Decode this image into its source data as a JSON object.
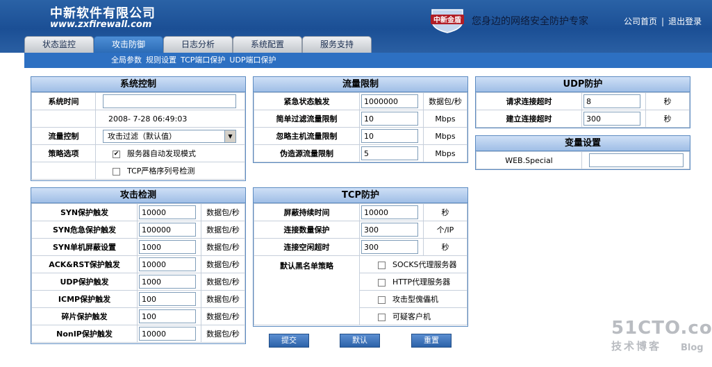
{
  "header": {
    "company": "中新软件有限公司",
    "url": "www.zxfirewall.com",
    "badge_text": "中新金盾",
    "slogan": "您身边的网络安全防护专家",
    "links": [
      "公司首页",
      "退出登录"
    ],
    "link_sep": "|"
  },
  "tabs": [
    {
      "label": "状态监控",
      "active": false
    },
    {
      "label": "攻击防御",
      "active": true
    },
    {
      "label": "日志分析",
      "active": false
    },
    {
      "label": "系统配置",
      "active": false
    },
    {
      "label": "服务支持",
      "active": false
    }
  ],
  "subnav": [
    "全局参数",
    "规则设置",
    "TCP端口保护",
    "UDP端口保护"
  ],
  "system_control": {
    "title": "系统控制",
    "time_label": "系统时间",
    "time_value": "",
    "datetime": "2008- 7-28 06:49:03",
    "flow_label": "流量控制",
    "flow_selected": "攻击过滤（默认值）",
    "policy_label": "策略选项",
    "option1": "服务器自动发现模式",
    "option1_checked": true,
    "option1_mark": "✔",
    "option2": "TCP严格序列号检测",
    "option2_checked": false
  },
  "traffic_limit": {
    "title": "流量限制",
    "rows": [
      {
        "label": "紧急状态触发",
        "value": "1000000",
        "unit": "数据包/秒"
      },
      {
        "label": "简单过滤流量限制",
        "value": "10",
        "unit": "Mbps"
      },
      {
        "label": "忽略主机流量限制",
        "value": "10",
        "unit": "Mbps"
      },
      {
        "label": "伪造源流量限制",
        "value": "5",
        "unit": "Mbps"
      }
    ]
  },
  "udp_protect": {
    "title": "UDP防护",
    "rows": [
      {
        "label": "请求连接超时",
        "value": "8",
        "unit": "秒"
      },
      {
        "label": "建立连接超时",
        "value": "300",
        "unit": "秒"
      }
    ]
  },
  "variables": {
    "title": "变量设置",
    "label": "WEB.Special",
    "value": ""
  },
  "attack_detect": {
    "title": "攻击检测",
    "rows": [
      {
        "label": "SYN保护触发",
        "value": "10000",
        "unit": "数据包/秒"
      },
      {
        "label": "SYN危急保护触发",
        "value": "100000",
        "unit": "数据包/秒"
      },
      {
        "label": "SYN单机屏蔽设置",
        "value": "1000",
        "unit": "数据包/秒"
      },
      {
        "label": "ACK&RST保护触发",
        "value": "10000",
        "unit": "数据包/秒"
      },
      {
        "label": "UDP保护触发",
        "value": "1000",
        "unit": "数据包/秒"
      },
      {
        "label": "ICMP保护触发",
        "value": "100",
        "unit": "数据包/秒"
      },
      {
        "label": "碎片保护触发",
        "value": "100",
        "unit": "数据包/秒"
      },
      {
        "label": "NonIP保护触发",
        "value": "10000",
        "unit": "数据包/秒"
      }
    ]
  },
  "tcp_protect": {
    "title": "TCP防护",
    "rows": [
      {
        "label": "屏蔽持续时间",
        "value": "10000",
        "unit": "秒"
      },
      {
        "label": "连接数量保护",
        "value": "300",
        "unit": "个/IP"
      },
      {
        "label": "连接空闲超时",
        "value": "300",
        "unit": "秒"
      }
    ],
    "blacklist_label": "默认黑名单策略",
    "blacklist": [
      {
        "label": "SOCKS代理服务器",
        "checked": false
      },
      {
        "label": "HTTP代理服务器",
        "checked": false
      },
      {
        "label": "攻击型傀儡机",
        "checked": false
      },
      {
        "label": "可疑客户机",
        "checked": false
      }
    ]
  },
  "buttons": {
    "submit": "提交",
    "default": "默认",
    "reset": "重置"
  },
  "watermark": {
    "line1": "51CTO.com",
    "line2": "技术博客",
    "line3": "Blog"
  },
  "colors": {
    "header_blue": "#1b4f95",
    "subnav_blue": "#2d70c2",
    "panel_border": "#5b8ac0",
    "panel_head": "#cfe0f6"
  }
}
